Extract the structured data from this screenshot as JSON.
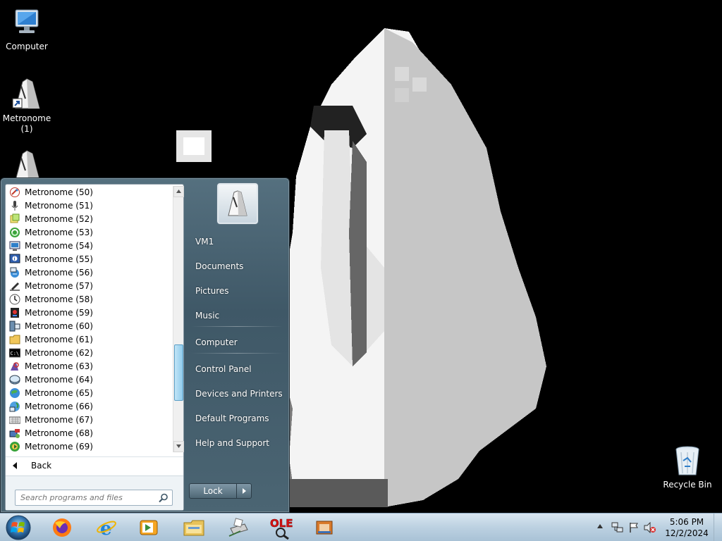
{
  "desktop": {
    "icons": [
      {
        "label": "Computer",
        "icon": "computer-icon"
      },
      {
        "label": "Metronome (1)",
        "icon": "metronome-shortcut-icon"
      },
      {
        "label": "",
        "icon": "metronome-shortcut-icon"
      },
      {
        "label": "Recycle Bin",
        "icon": "recycle-bin-icon"
      }
    ]
  },
  "start_menu": {
    "programs": [
      {
        "label": "Metronome (50)",
        "icon": "paint-icon"
      },
      {
        "label": "Metronome (51)",
        "icon": "microphone-icon"
      },
      {
        "label": "Metronome (52)",
        "icon": "sticky-notes-icon"
      },
      {
        "label": "Metronome (53)",
        "icon": "sync-center-icon"
      },
      {
        "label": "Metronome (54)",
        "icon": "remote-desktop-icon"
      },
      {
        "label": "Metronome (55)",
        "icon": "system-info-icon"
      },
      {
        "label": "Metronome (56)",
        "icon": "network-projector-icon"
      },
      {
        "label": "Metronome (57)",
        "icon": "edit-pencil-icon"
      },
      {
        "label": "Metronome (58)",
        "icon": "clock-icon"
      },
      {
        "label": "Metronome (59)",
        "icon": "media-center-icon"
      },
      {
        "label": "Metronome (60)",
        "icon": "remote-computer-icon"
      },
      {
        "label": "Metronome (61)",
        "icon": "folder-icon"
      },
      {
        "label": "Metronome (62)",
        "icon": "command-prompt-icon"
      },
      {
        "label": "Metronome (63)",
        "icon": "magnifier-icon"
      },
      {
        "label": "Metronome (64)",
        "icon": "disk-cleanup-icon"
      },
      {
        "label": "Metronome (65)",
        "icon": "internet-globe-icon"
      },
      {
        "label": "Metronome (66)",
        "icon": "network-globe-icon"
      },
      {
        "label": "Metronome (67)",
        "icon": "keyboard-icon"
      },
      {
        "label": "Metronome (68)",
        "icon": "mobility-center-icon"
      },
      {
        "label": "Metronome (69)",
        "icon": "windows-media-icon"
      }
    ],
    "back_label": "Back",
    "search_placeholder": "Search programs and files",
    "right_items": [
      {
        "label": "VM1",
        "name": "user-folder"
      },
      {
        "label": "Documents",
        "name": "documents"
      },
      {
        "label": "Pictures",
        "name": "pictures"
      },
      {
        "label": "Music",
        "name": "music"
      },
      {
        "label": "Computer",
        "name": "computer"
      },
      {
        "label": "Control Panel",
        "name": "control-panel"
      },
      {
        "label": "Devices and Printers",
        "name": "devices-and-printers"
      },
      {
        "label": "Default Programs",
        "name": "default-programs"
      },
      {
        "label": "Help and Support",
        "name": "help-and-support"
      }
    ],
    "lock_label": "Lock"
  },
  "taskbar": {
    "apps": [
      "firefox-icon",
      "internet-explorer-icon",
      "media-player-icon",
      "file-explorer-icon",
      "printer-scanner-icon",
      "ole-viewer-icon",
      "film-app-icon"
    ],
    "tray_icons": [
      "show-hidden-icons-arrow",
      "network-icon",
      "action-center-flag-icon",
      "volume-muted-icon"
    ],
    "time": "5:06 PM",
    "date": "12/2/2024"
  },
  "colors": {
    "start_menu_right": "#4b6573",
    "taskbar": "#bcd1e1",
    "scroll_thumb": "#8fcbec"
  }
}
